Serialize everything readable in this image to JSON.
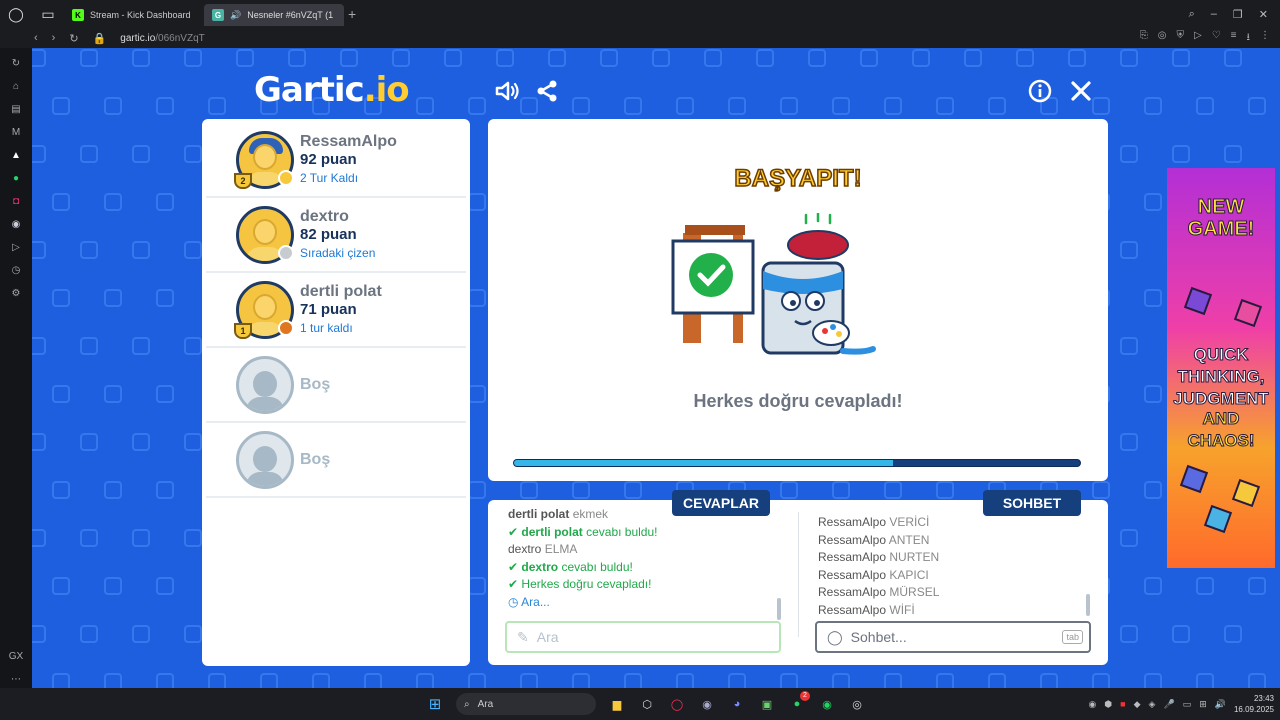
{
  "browser": {
    "tabs": [
      {
        "label": "Stream - Kick Dashboard",
        "favicon": "K",
        "active": false
      },
      {
        "label": "Nesneler #6nVZqT (1",
        "favicon": "G",
        "active": true
      }
    ],
    "url_host": "gartic.io",
    "url_path": "/066nVZqT"
  },
  "game": {
    "logo": "Gartic",
    "logo_suffix": ".io",
    "players": [
      {
        "name": "RessamAlpo",
        "points": "92 puan",
        "sub": "2 Tur Kaldı",
        "trophy": "2",
        "status_color": "#f6c83c",
        "hair": true
      },
      {
        "name": "dextro",
        "points": "82 puan",
        "sub": "Sıradaki çizen",
        "trophy": "",
        "status_color": "#c8ccd0",
        "hair": false
      },
      {
        "name": "dertli polat",
        "points": "71 puan",
        "sub": "1 tur kaldı",
        "trophy": "1",
        "status_color": "#e0761f",
        "hair": false
      },
      {
        "name": "Boş",
        "empty": true
      },
      {
        "name": "Boş",
        "empty": true
      }
    ],
    "banner": "BAŞYAPIT!",
    "message": "Herkes doğru cevapladı!",
    "progress": 0.67,
    "answers_header": "CEVAPLAR",
    "chat_header": "SOHBET",
    "answers": [
      {
        "who": "dertli polat",
        "text": "ekmek",
        "type": "partial"
      },
      {
        "who": "dertli polat",
        "text": "cevabı buldu!",
        "type": "correct"
      },
      {
        "who": "dextro",
        "text": "ELMA",
        "type": "guess"
      },
      {
        "who": "dextro",
        "text": "cevabı buldu!",
        "type": "correct"
      },
      {
        "who": "",
        "text": "Herkes doğru cevapladı!",
        "type": "all"
      },
      {
        "who": "",
        "text": "Ara...",
        "type": "wait"
      }
    ],
    "chat": [
      {
        "who": "RessamAlpo",
        "text": "VERİCİ"
      },
      {
        "who": "RessamAlpo",
        "text": "ANTEN"
      },
      {
        "who": "RessamAlpo",
        "text": "NURTEN"
      },
      {
        "who": "RessamAlpo",
        "text": "KAPICI"
      },
      {
        "who": "RessamAlpo",
        "text": "MÜRSEL"
      },
      {
        "who": "RessamAlpo",
        "text": "WİFİ"
      }
    ],
    "answer_placeholder": "Ara",
    "chat_placeholder": "Sohbet...",
    "tab_key": "tab"
  },
  "ad": {
    "line1": "NEW GAME!",
    "line2": "QUICK THINKING, JUDGMENT",
    "line3": "AND CHAOS!"
  },
  "taskbar": {
    "search": "Ara",
    "time": "23:43",
    "date": "16.09.2025",
    "badge": "2"
  }
}
